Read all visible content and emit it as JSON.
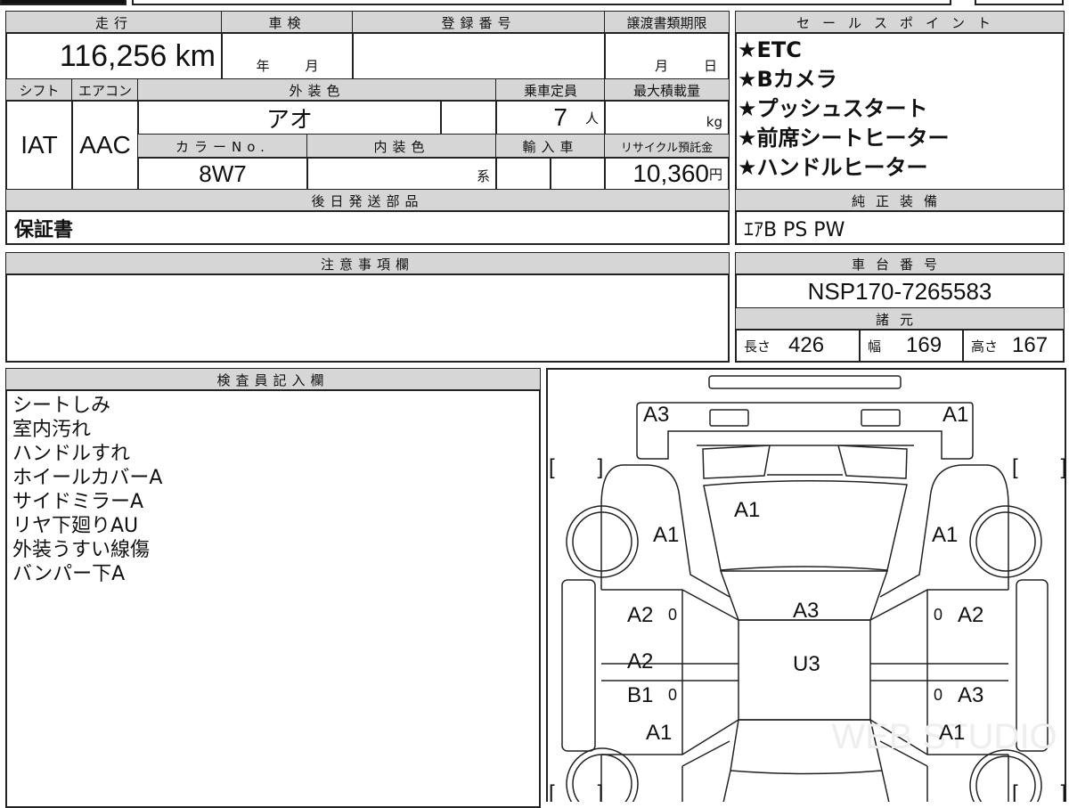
{
  "vehicle": {
    "mileage_label": "走行",
    "mileage": "116,256 km",
    "inspection_label": "車検",
    "inspection_year_unit": "年",
    "inspection_month_unit": "月",
    "registration_label": "登録番号",
    "transfer_deadline_label": "譲渡書類期限",
    "transfer_month_unit": "月",
    "transfer_day_unit": "日",
    "shift_label": "シフト",
    "shift": "IAT",
    "ac_label": "エアコン",
    "ac": "AAC",
    "exterior_color_label": "外装色",
    "exterior_color": "アオ",
    "capacity_label": "乗車定員",
    "capacity": "7",
    "capacity_unit": "人",
    "max_load_label": "最大積載量",
    "max_load_unit": "kg",
    "color_no_label": "カラーNo.",
    "color_no": "8W7",
    "interior_color_label": "内装色",
    "interior_color_unit": "系",
    "import_label": "輸入車",
    "recycle_label": "リサイクル預託金",
    "recycle_fee": "10,360",
    "recycle_unit": "円",
    "later_parts_label": "後日発送部品",
    "later_parts": "保証書"
  },
  "notes_section": {
    "label": "注意事項欄"
  },
  "sales_points": {
    "label": "セールスポイント",
    "items": [
      "★ETC",
      "★Bカメラ",
      "★プッシュスタート",
      "★前席シートヒーター",
      "★ハンドルヒーター"
    ]
  },
  "equipment": {
    "label": "純正装備",
    "value": "ｴｱB PS PW"
  },
  "chassis": {
    "label": "車台番号",
    "value": "NSP170-7265583"
  },
  "specs": {
    "label": "諸元",
    "length_label": "長さ",
    "length": "426",
    "width_label": "幅",
    "width": "169",
    "height_label": "高さ",
    "height": "167"
  },
  "inspector": {
    "label": "検査員記入欄",
    "lines": [
      "シートしみ",
      "室内汚れ",
      "ハンドルすれ",
      "ホイールカバーA",
      "サイドミラーA",
      "リヤ下廻りAU",
      "外装うすい線傷",
      "バンパー下A"
    ]
  },
  "diagram": {
    "labels": [
      "A3",
      "A1",
      "A1",
      "A1",
      "A1",
      "A2",
      "0",
      "A3",
      "0",
      "A2",
      "A2",
      "U3",
      "B1",
      "0",
      "0",
      "A3",
      "A1",
      "A1"
    ],
    "bracket": "[　　]",
    "watermark": "WEB STUDIO"
  }
}
